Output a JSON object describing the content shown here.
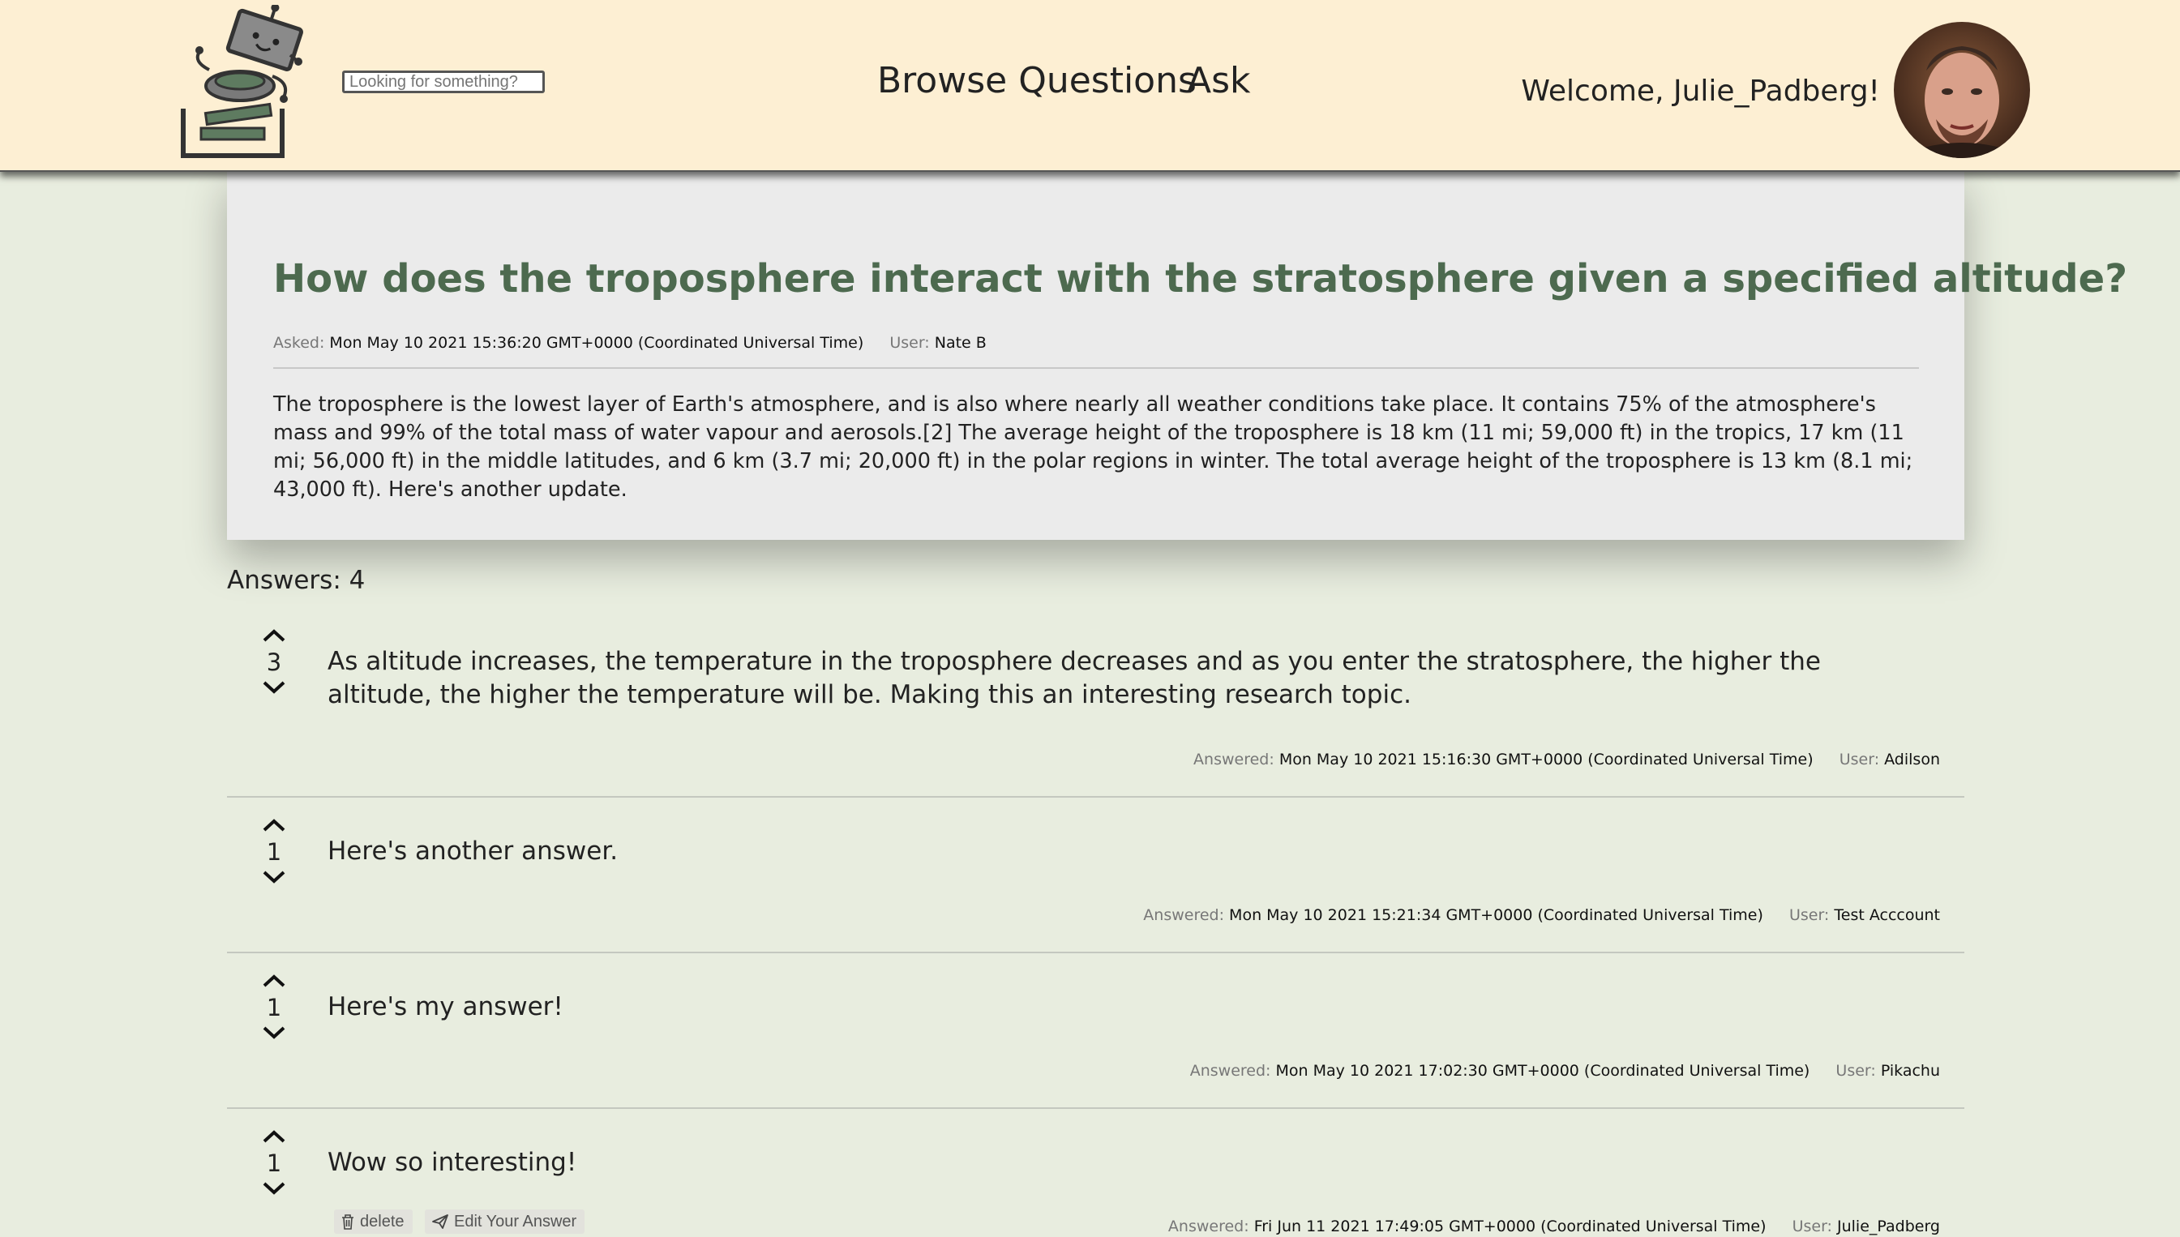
{
  "header": {
    "search_placeholder": "Looking for something?",
    "nav": {
      "browse_label": "Browse Questions",
      "ask_label": "Ask"
    },
    "welcome_text": "Welcome, Julie_Padberg!",
    "logo_icon": "robot-stack-logo-icon",
    "avatar_icon": "user-avatar"
  },
  "question": {
    "title": "How does the troposphere interact with the stratosphere given a specified altitude?",
    "asked_label": "Asked:",
    "asked_date": "Mon May 10 2021 15:36:20 GMT+0000 (Coordinated Universal Time)",
    "user_label": "User:",
    "user": "Nate B",
    "body": "The troposphere is the lowest layer of Earth's atmosphere, and is also where nearly all weather conditions take place. It contains 75% of the atmosphere's mass and 99% of the total mass of water vapour and aerosols.[2] The average height of the troposphere is 18 km (11 mi; 59,000 ft) in the tropics, 17 km (11 mi; 56,000 ft) in the middle latitudes, and 6 km (3.7 mi; 20,000 ft) in the polar regions in winter. The total average height of the troposphere is 13 km (8.1 mi; 43,000 ft). Here's another update."
  },
  "answers_label": "Answers: 4",
  "answers": [
    {
      "votes": "3",
      "text": "As altitude increases, the temperature in the troposphere decreases and as you enter the stratosphere, the higher the altitude, the higher the temperature will be. Making this an interesting research topic.",
      "answered_label": "Answered:",
      "date": "Mon May 10 2021 15:16:30 GMT+0000 (Coordinated Universal Time)",
      "user_label": "User:",
      "user": "Adilson"
    },
    {
      "votes": "1",
      "text": "Here's another answer.",
      "answered_label": "Answered:",
      "date": "Mon May 10 2021 15:21:34 GMT+0000 (Coordinated Universal Time)",
      "user_label": "User:",
      "user": "Test Acccount"
    },
    {
      "votes": "1",
      "text": "Here's my answer!",
      "answered_label": "Answered:",
      "date": "Mon May 10 2021 17:02:30 GMT+0000 (Coordinated Universal Time)",
      "user_label": "User:",
      "user": "Pikachu"
    },
    {
      "votes": "1",
      "text": "Wow so interesting!",
      "answered_label": "Answered:",
      "date": "Fri Jun 11 2021 17:49:05 GMT+0000 (Coordinated Universal Time)",
      "user_label": "User:",
      "user": "Julie_Padberg",
      "delete_label": "delete",
      "edit_label": "Edit Your Answer"
    }
  ],
  "colors": {
    "header_bg": "#fdefd3",
    "page_bg": "#e8eddf",
    "card_bg": "#ebebeb",
    "title_green": "#4d6a4f"
  }
}
